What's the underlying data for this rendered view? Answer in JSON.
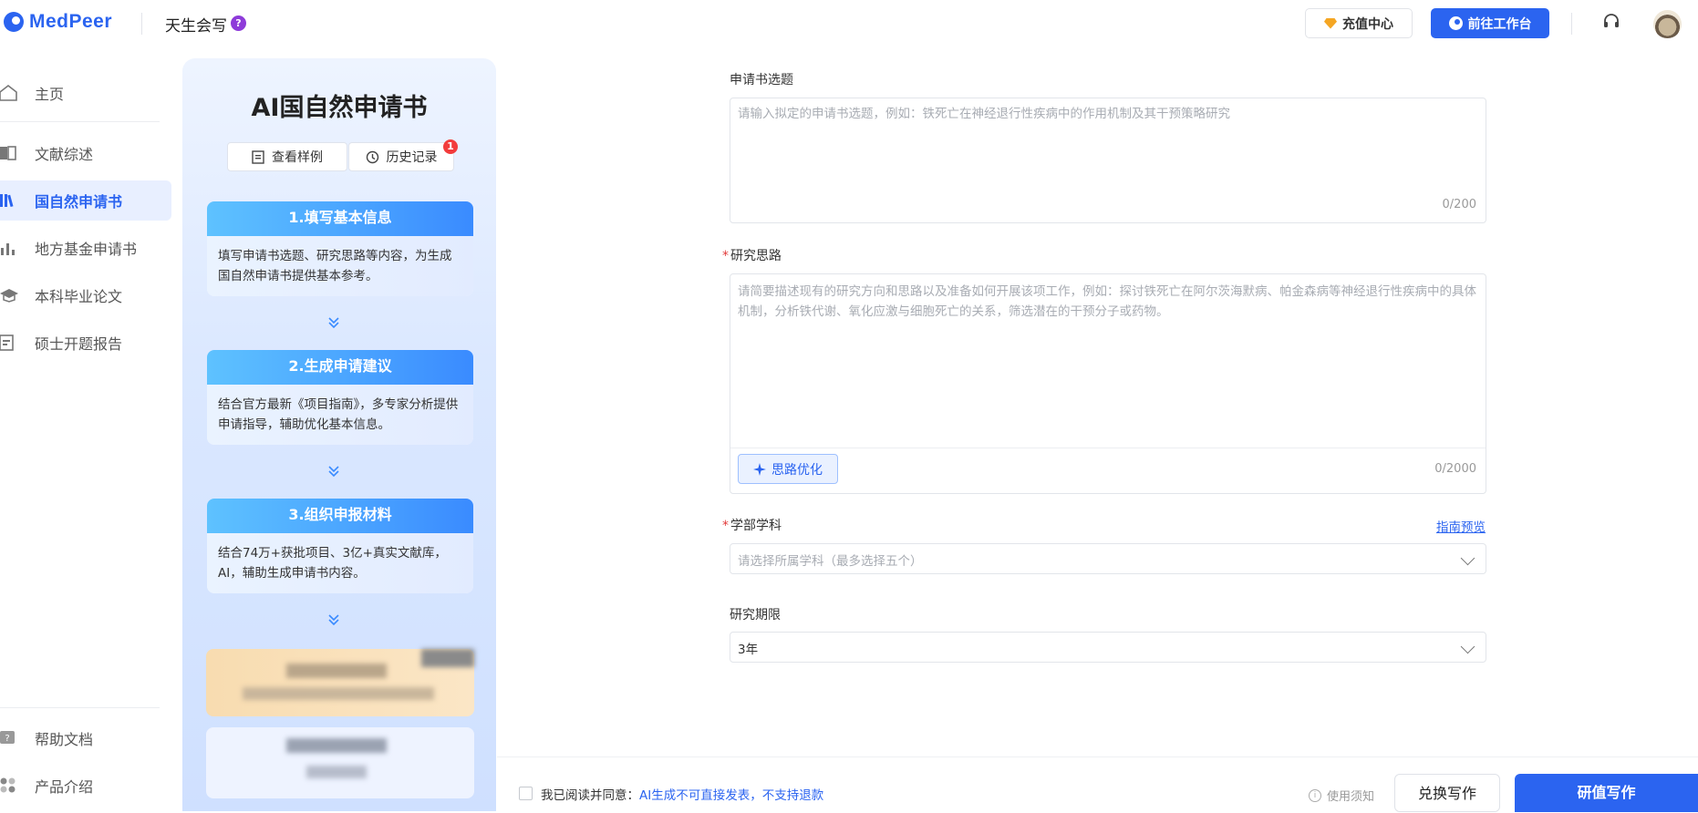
{
  "header": {
    "logo": "MedPeer",
    "product": "天生会写",
    "help_badge": "?",
    "recharge": "充值中心",
    "workbench": "前往工作台"
  },
  "sidebar": {
    "items": [
      {
        "label": "主页",
        "icon": "home-icon"
      },
      {
        "label": "文献综述",
        "icon": "book-icon"
      },
      {
        "label": "国自然申请书",
        "icon": "books-icon",
        "active": true
      },
      {
        "label": "地方基金申请书",
        "icon": "chart-icon"
      },
      {
        "label": "本科毕业论文",
        "icon": "graduation-cap-icon"
      },
      {
        "label": "硕士开题报告",
        "icon": "report-icon"
      }
    ],
    "bottom": [
      {
        "label": "帮助文档",
        "icon": "help-doc-icon"
      },
      {
        "label": "产品介绍",
        "icon": "product-icon"
      }
    ]
  },
  "panel": {
    "title": "AI国自然申请书",
    "view_sample": "查看样例",
    "history": "历史记录",
    "history_badge": "1",
    "steps": [
      {
        "title": "1.填写基本信息",
        "desc": "填写申请书选题、研究思路等内容，为生成国自然申请书提供基本参考。"
      },
      {
        "title": "2.生成申请建议",
        "desc": "结合官方最新《项目指南》，多专家分析提供申请指导，辅助优化基本信息。"
      },
      {
        "title": "3.组织申报材料",
        "desc": "结合74万+获批项目、3亿+真实文献库，AI，辅助生成申请书内容。"
      }
    ]
  },
  "form": {
    "topic_label": "申请书选题",
    "topic_placeholder": "请输入拟定的申请书选题，例如：铁死亡在神经退行性疾病中的作用机制及其干预策略研究",
    "topic_counter": "0/200",
    "idea_label": "研究思路",
    "idea_placeholder": "请简要描述现有的研究方向和思路以及准备如何开展该项工作，例如：探讨铁死亡在阿尔茨海默病、帕金森病等神经退行性疾病中的具体机制，分析铁代谢、氧化应激与细胞死亡的关系，筛选潜在的干预分子或药物。",
    "idea_counter": "0/2000",
    "optimize": "思路优化",
    "subject_label": "学部学科",
    "guide_link": "指南预览",
    "subject_placeholder": "请选择所属学科（最多选择五个）",
    "period_label": "研究期限",
    "period_value": "3年",
    "required_mark": "*"
  },
  "footer": {
    "agree": "我已阅读并同意：",
    "agree_link": "AI生成不可直接发表，不支持退款",
    "notice": "使用须知",
    "switch": "兑换写作",
    "write": "研值写作"
  },
  "colors": {
    "accent": "#2b64f0",
    "required": "#e23b3b"
  }
}
